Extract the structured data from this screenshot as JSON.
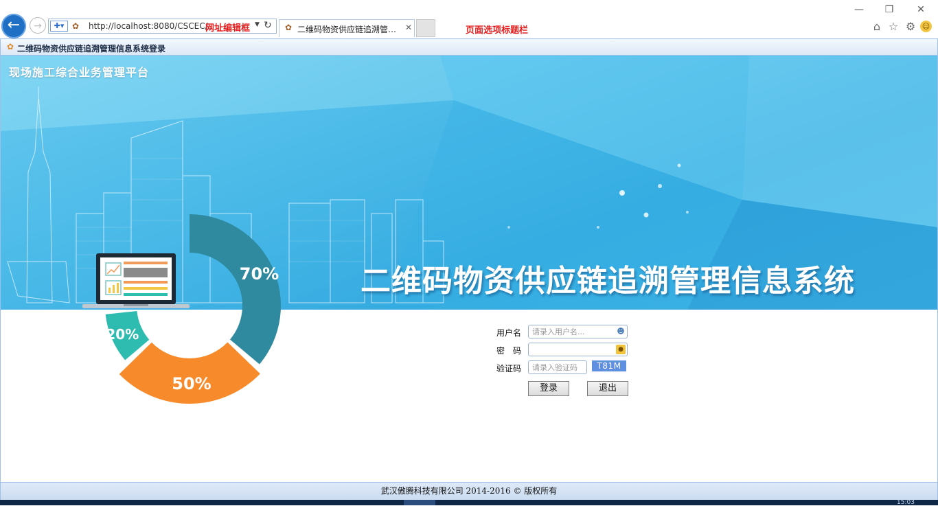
{
  "browser": {
    "url": "http://localhost:8080/CSCEC/",
    "url_annotation": "网址编辑框",
    "tab_title": "二维码物资供应链追溯管理...",
    "tab_annotation": "页面选项标题栏"
  },
  "icons": {
    "back": "arrow-left",
    "forward": "arrow-right",
    "home": "home",
    "favorites": "star",
    "settings": "gear",
    "feedback": "smiley",
    "user": "user",
    "lock": "lock"
  },
  "page": {
    "title": "二维码物资供应链追溯管理信息系统登录"
  },
  "banner": {
    "platform_title": "现场施工综合业务管理平台",
    "system_title": "二维码物资供应链追溯管理信息系统",
    "donut": [
      {
        "label": "70%",
        "percent": 70,
        "color": "#2f8a9f"
      },
      {
        "label": "50%",
        "percent": 50,
        "color": "#f78a2a"
      },
      {
        "label": "20%",
        "percent": 20,
        "color": "#2fbcb0"
      }
    ]
  },
  "login": {
    "username_label": "用户名",
    "username_placeholder": "请录入用户名...",
    "password_label": "密　码",
    "captcha_label": "验证码",
    "captcha_placeholder": "请录入验证码",
    "captcha_code": "T81M",
    "login_button": "登录",
    "exit_button": "退出"
  },
  "footer": {
    "copyright": "武汉傲腾科技有限公司 2014-2016 © 版权所有"
  },
  "taskbar": {
    "clock": "15:03"
  },
  "colors": {
    "accent": "#1f6fc4",
    "banner": "#3cb3e5",
    "annotation": "#e41f1f"
  }
}
